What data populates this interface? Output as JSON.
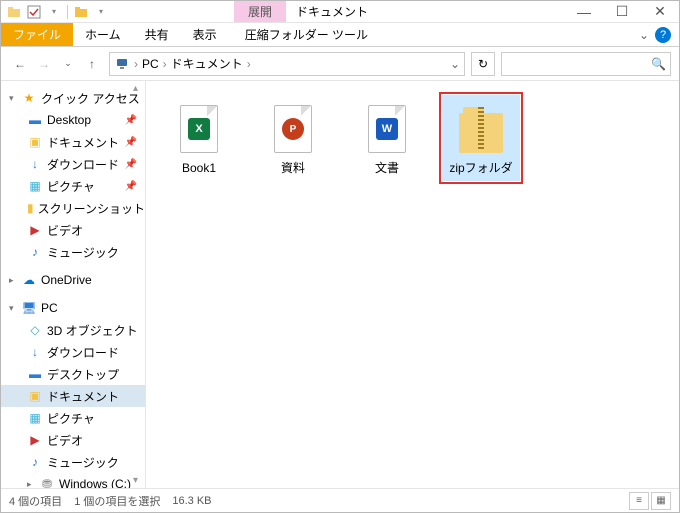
{
  "titlebar": {
    "context_tab": "展開",
    "title": "ドキュメント"
  },
  "ribbon": {
    "file": "ファイル",
    "home": "ホーム",
    "share": "共有",
    "view": "表示",
    "tool": "圧縮フォルダー ツール"
  },
  "breadcrumb": {
    "segments": [
      "PC",
      "ドキュメント"
    ]
  },
  "search": {
    "placeholder": ""
  },
  "sidebar": {
    "quick_access": "クイック アクセス",
    "items_qa": [
      {
        "label": "Desktop",
        "icon": "desktop",
        "pinned": true
      },
      {
        "label": "ドキュメント",
        "icon": "folder",
        "pinned": true
      },
      {
        "label": "ダウンロード",
        "icon": "dl",
        "pinned": true
      },
      {
        "label": "ピクチャ",
        "icon": "pic",
        "pinned": true
      },
      {
        "label": "スクリーンショット",
        "icon": "folder",
        "pinned": false
      },
      {
        "label": "ビデオ",
        "icon": "vid",
        "pinned": false
      },
      {
        "label": "ミュージック",
        "icon": "music",
        "pinned": false
      }
    ],
    "onedrive": "OneDrive",
    "pc": "PC",
    "items_pc": [
      {
        "label": "3D オブジェクト",
        "icon": "obj"
      },
      {
        "label": "ダウンロード",
        "icon": "dl"
      },
      {
        "label": "デスクトップ",
        "icon": "desktop"
      },
      {
        "label": "ドキュメント",
        "icon": "folder",
        "selected": true
      },
      {
        "label": "ピクチャ",
        "icon": "pic"
      },
      {
        "label": "ビデオ",
        "icon": "vid"
      },
      {
        "label": "ミュージック",
        "icon": "music"
      },
      {
        "label": "Windows (C:)",
        "icon": "drive"
      }
    ]
  },
  "files": [
    {
      "label": "Book1",
      "type": "excel",
      "selected": false
    },
    {
      "label": "資料",
      "type": "ppt",
      "selected": false
    },
    {
      "label": "文書",
      "type": "word",
      "selected": false
    },
    {
      "label": "zipフォルダ",
      "type": "zip",
      "selected": true
    }
  ],
  "status": {
    "count": "4 個の項目",
    "selected": "1 個の項目を選択",
    "size": "16.3 KB"
  }
}
